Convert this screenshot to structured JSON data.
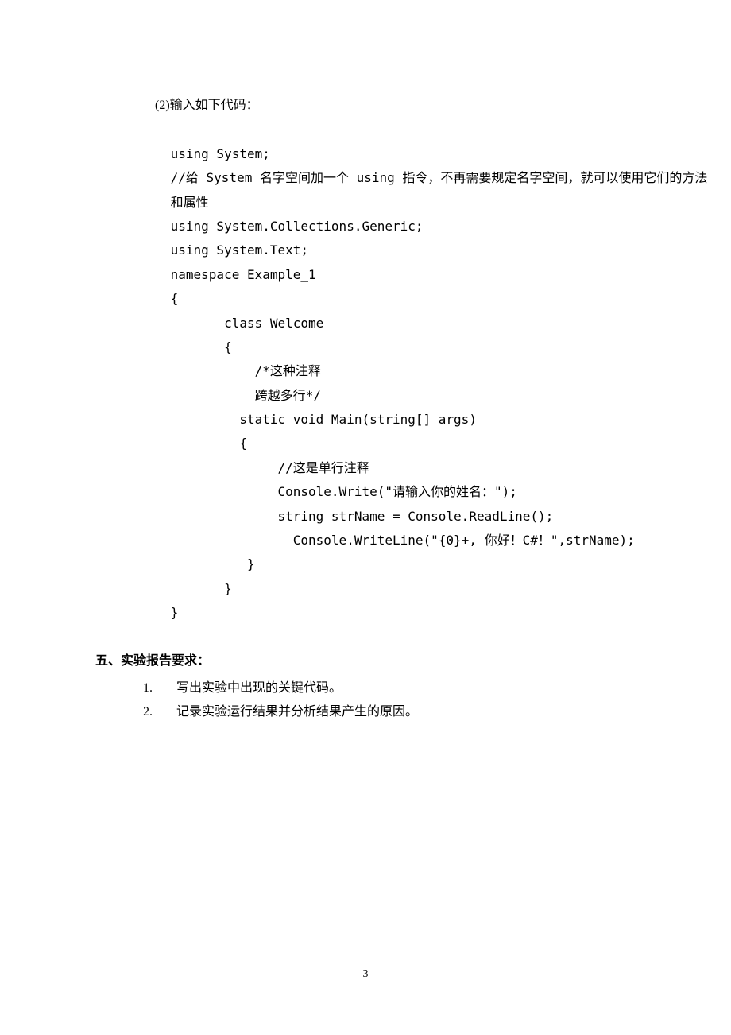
{
  "intro": "(2)输入如下代码：",
  "code": {
    "line1": " using System;",
    "line2": " //给 System 名字空间加一个 using 指令，不再需要规定名字空间，就可以使用它们的方法",
    "line3": " 和属性",
    "line4": " using System.Collections.Generic;",
    "line5": " using System.Text;",
    "line6": " namespace Example_1",
    "line7": " {",
    "line8": "        class Welcome",
    "line9": "        {",
    "line10": "            /*这种注释",
    "line11": "            跨越多行*/",
    "line12": "          static void Main(string[] args)",
    "line13": "          {",
    "line14": "               //这是单行注释",
    "line15": "               Console.Write(\"请输入你的姓名：\");",
    "line16": "               string strName = Console.ReadLine();",
    "line17": "                 Console.WriteLine(\"{0}+, 你好！C#！\",strName);",
    "line18": "           }",
    "line19": "        }",
    "line20": " }"
  },
  "heading": "五、实验报告要求：",
  "items": [
    {
      "num": "1.",
      "text": "写出实验中出现的关键代码。"
    },
    {
      "num": "2.",
      "text": "记录实验运行结果并分析结果产生的原因。"
    }
  ],
  "page_number": "3"
}
